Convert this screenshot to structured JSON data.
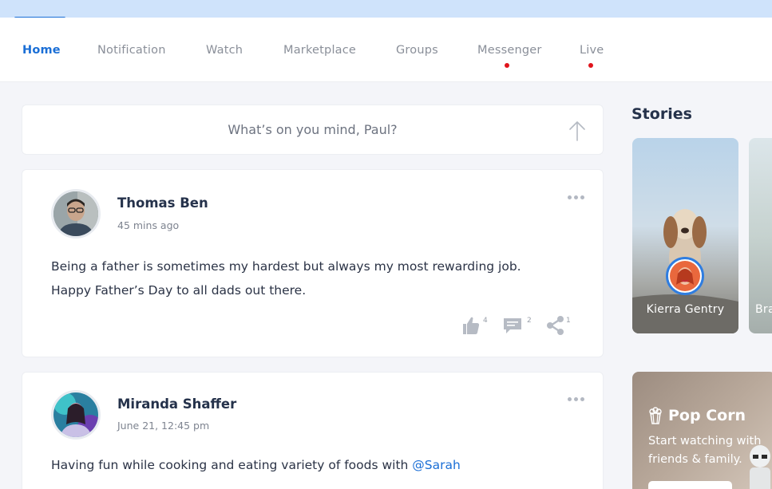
{
  "nav": {
    "items": [
      {
        "label": "Home"
      },
      {
        "label": "Notification"
      },
      {
        "label": "Watch"
      },
      {
        "label": "Marketplace"
      },
      {
        "label": "Groups"
      },
      {
        "label": "Messenger"
      },
      {
        "label": "Live"
      }
    ]
  },
  "composer": {
    "placeholder": "What’s on you mind, Paul?"
  },
  "posts": [
    {
      "author": "Thomas Ben",
      "time": "45 mins ago",
      "lines": [
        "Being a father is sometimes my hardest but always my most rewarding job.",
        "Happy Father’s Day to all dads out there."
      ],
      "likes": "4",
      "comments": "2",
      "shares": "1"
    },
    {
      "author": "Miranda Shaffer",
      "time": "June 21, 12:45 pm",
      "text": "Having fun while cooking and eating variety of foods with ",
      "mention": "@Sarah"
    }
  ],
  "stories": {
    "title": "Stories",
    "items": [
      {
        "name": "Kierra Gentry"
      },
      {
        "name": "Bra"
      }
    ]
  },
  "promo": {
    "title": "Pop Corn",
    "subtitle": "Start watching with friends & family."
  },
  "colors": {
    "accent": "#1b6fd6",
    "notification_dot": "#e0141c",
    "top_strip": "#cfe3fb"
  }
}
